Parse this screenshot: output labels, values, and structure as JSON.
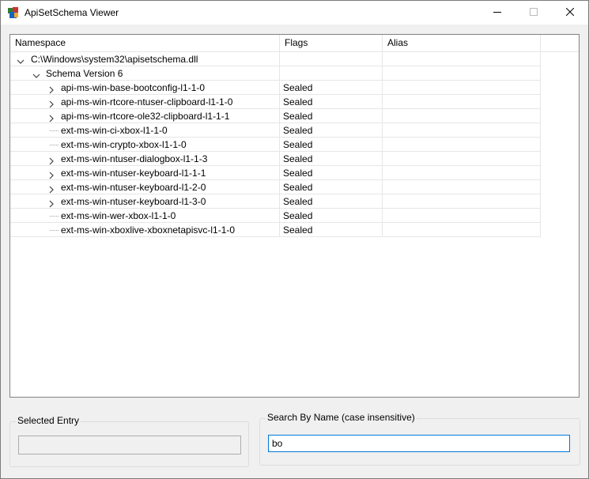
{
  "window": {
    "title": "ApiSetSchema Viewer"
  },
  "icons": {
    "app": "app-logo-icon",
    "minimize": "minimize-icon",
    "maximize": "maximize-icon",
    "close": "close-icon",
    "expanded": "chevron-down-icon",
    "collapsed": "chevron-right-icon"
  },
  "grid": {
    "columns": [
      "Namespace",
      "Flags",
      "Alias"
    ],
    "root": {
      "label": "C:\\Windows\\system32\\apisetschema.dll",
      "expanded": true
    },
    "schema": {
      "label": "Schema Version 6",
      "expanded": true
    },
    "entries": [
      {
        "name": "api-ms-win-base-bootconfig-l1-1-0",
        "flags": "Sealed",
        "alias": "",
        "expandable": true
      },
      {
        "name": "api-ms-win-rtcore-ntuser-clipboard-l1-1-0",
        "flags": "Sealed",
        "alias": "",
        "expandable": true
      },
      {
        "name": "api-ms-win-rtcore-ole32-clipboard-l1-1-1",
        "flags": "Sealed",
        "alias": "",
        "expandable": true
      },
      {
        "name": "ext-ms-win-ci-xbox-l1-1-0",
        "flags": "Sealed",
        "alias": "",
        "expandable": false
      },
      {
        "name": "ext-ms-win-crypto-xbox-l1-1-0",
        "flags": "Sealed",
        "alias": "",
        "expandable": false
      },
      {
        "name": "ext-ms-win-ntuser-dialogbox-l1-1-3",
        "flags": "Sealed",
        "alias": "",
        "expandable": true
      },
      {
        "name": "ext-ms-win-ntuser-keyboard-l1-1-1",
        "flags": "Sealed",
        "alias": "",
        "expandable": true
      },
      {
        "name": "ext-ms-win-ntuser-keyboard-l1-2-0",
        "flags": "Sealed",
        "alias": "",
        "expandable": true
      },
      {
        "name": "ext-ms-win-ntuser-keyboard-l1-3-0",
        "flags": "Sealed",
        "alias": "",
        "expandable": true
      },
      {
        "name": "ext-ms-win-wer-xbox-l1-1-0",
        "flags": "Sealed",
        "alias": "",
        "expandable": false
      },
      {
        "name": "ext-ms-win-xboxlive-xboxnetapisvc-l1-1-0",
        "flags": "Sealed",
        "alias": "",
        "expandable": false
      }
    ]
  },
  "selected_entry": {
    "label": "Selected Entry",
    "value": ""
  },
  "search": {
    "label": "Search By Name (case insensitive)",
    "value": "bo"
  },
  "colors": {
    "focus_border": "#0078d7",
    "grid_line": "#e6e6e6",
    "window_bg": "#f0f0f0"
  }
}
